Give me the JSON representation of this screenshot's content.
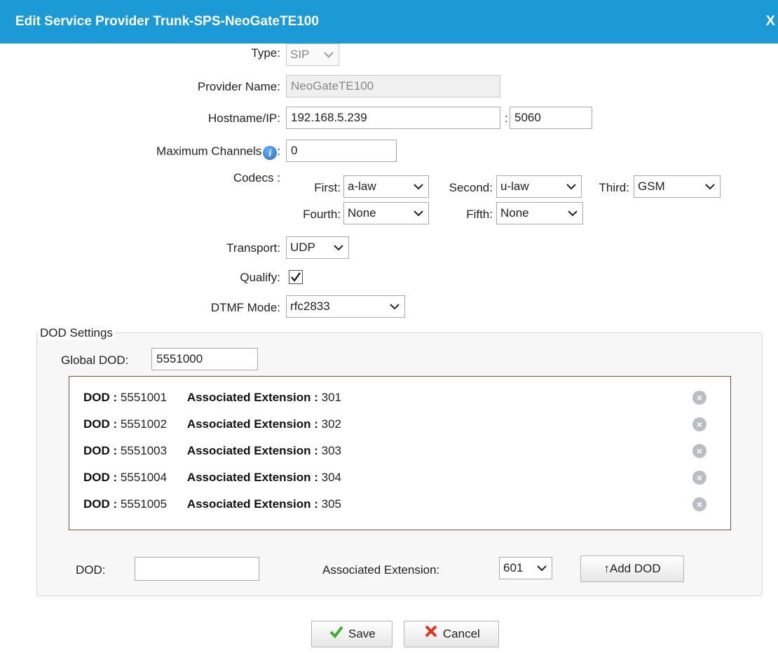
{
  "dialog": {
    "title": "Edit Service Provider Trunk-SPS-NeoGateTE100",
    "close_label": "X"
  },
  "form": {
    "type_label": "Type:",
    "type_value": "SIP",
    "provider_name_label": "Provider Name:",
    "provider_name_value": "NeoGateTE100",
    "hostname_label": "Hostname/IP:",
    "hostname_value": "192.168.5.239",
    "port_separator": ":",
    "port_value": "5060",
    "max_channels_label": "Maximum Channels",
    "max_channels_suffix": ":",
    "max_channels_value": "0",
    "codecs_label": "Codecs :",
    "codecs": {
      "first_label": "First:",
      "first_value": "a-law",
      "second_label": "Second:",
      "second_value": "u-law",
      "third_label": "Third:",
      "third_value": "GSM",
      "fourth_label": "Fourth:",
      "fourth_value": "None",
      "fifth_label": "Fifth:",
      "fifth_value": "None"
    },
    "transport_label": "Transport:",
    "transport_value": "UDP",
    "qualify_label": "Qualify:",
    "qualify_checked": true,
    "dtmf_label": "DTMF Mode:",
    "dtmf_value": "rfc2833"
  },
  "dod_settings": {
    "legend": "DOD Settings",
    "global_dod_label": "Global DOD:",
    "global_dod_value": "5551000",
    "dod_key": "DOD :",
    "ext_key": "Associated Extension :",
    "entries": [
      {
        "dod": "5551001",
        "ext": "301"
      },
      {
        "dod": "5551002",
        "ext": "302"
      },
      {
        "dod": "5551003",
        "ext": "303"
      },
      {
        "dod": "5551004",
        "ext": "304"
      },
      {
        "dod": "5551005",
        "ext": "305"
      }
    ],
    "new_dod_label": "DOD:",
    "new_dod_value": "",
    "assoc_ext_label": "Associated Extension:",
    "assoc_ext_value": "601",
    "add_button_label": "↑Add DOD"
  },
  "buttons": {
    "save_label": "Save",
    "cancel_label": "Cancel"
  },
  "colors": {
    "title_bar": "#1b9ad6",
    "list_border": "#7a5230",
    "save_check": "#3fae2a",
    "cancel_x": "#e0331f"
  }
}
